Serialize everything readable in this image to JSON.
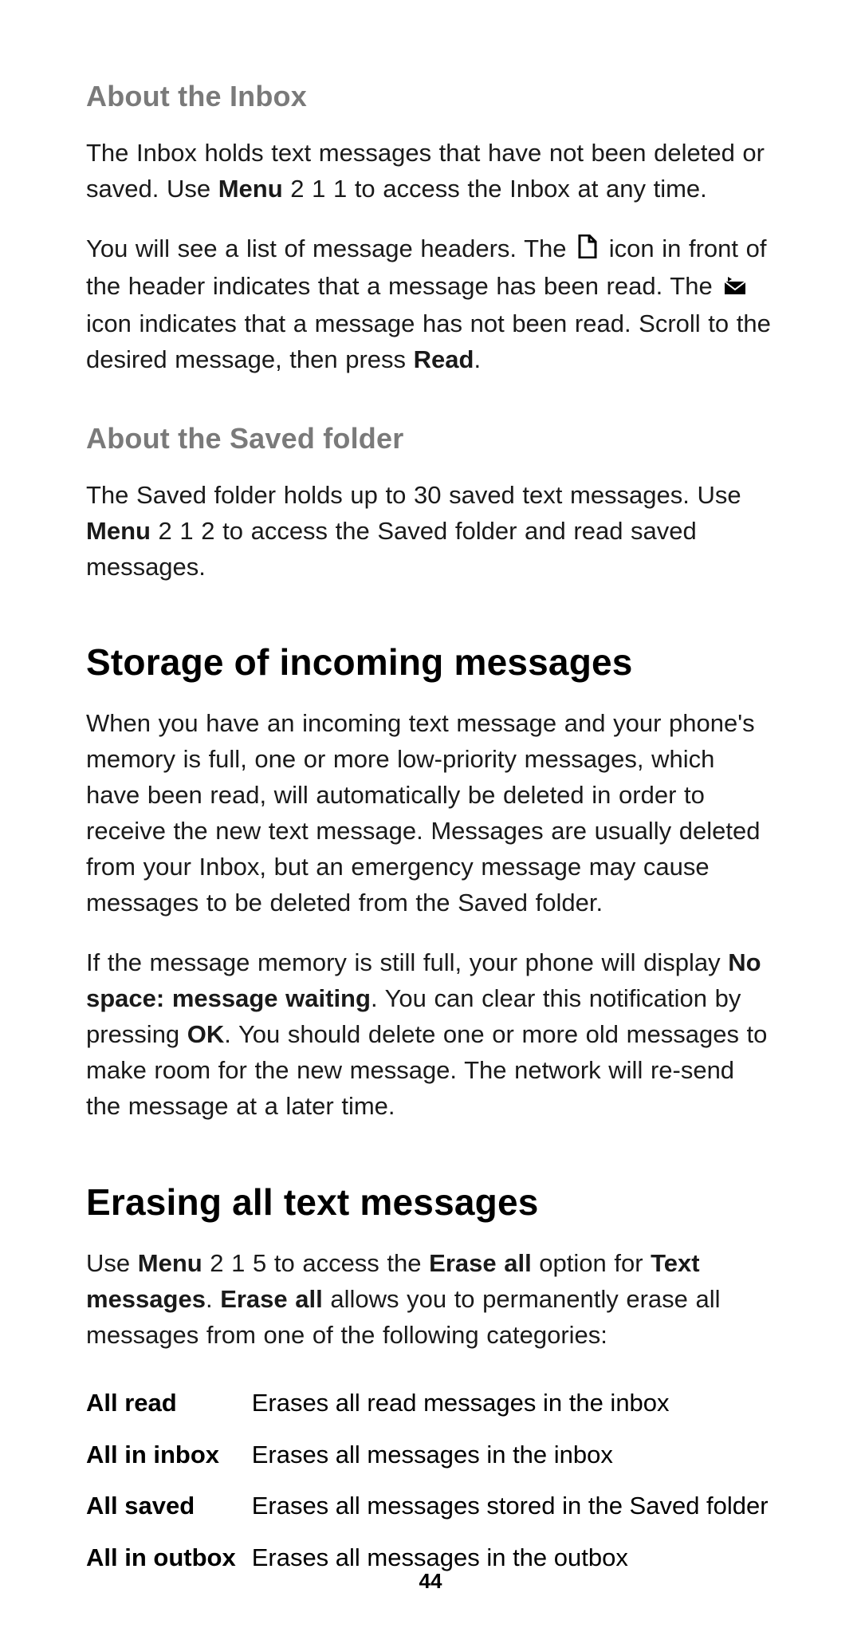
{
  "sec_inbox": {
    "heading": "About the Inbox",
    "p1_a": "The Inbox holds text messages that have not been deleted or saved. Use ",
    "p1_menu": "Menu",
    "p1_b": " 2 1 1 to access the Inbox at any time.",
    "p2_a": "You will see a list of message headers. The ",
    "p2_b": " icon in front of the header indicates that a message has been read. The ",
    "p2_c": " icon indicates that a message has not been read. Scroll to the desired message, then press ",
    "p2_read": "Read",
    "p2_d": "."
  },
  "sec_saved": {
    "heading": "About the Saved folder",
    "p1_a": "The Saved folder holds up to 30 saved text messages. Use ",
    "p1_menu": "Menu",
    "p1_b": " 2 1 2 to access the Saved folder and read saved messages."
  },
  "sec_storage": {
    "heading": "Storage of incoming messages",
    "p1": "When you have an incoming text message and your phone's memory is full, one or more low-priority messages, which have been read, will automatically be deleted in order to receive the new text message. Messages are usually deleted from your Inbox, but an emergency message may cause messages to be deleted from the Saved folder.",
    "p2_a": "If the message memory is still full, your phone will display ",
    "p2_nospace": "No space: message waiting",
    "p2_b": ". You can clear this notification by pressing ",
    "p2_ok": "OK",
    "p2_c": ". You should delete one or more old messages to make room for the new message. The network will re-send the message at a later time."
  },
  "sec_erase": {
    "heading": "Erasing all text messages",
    "p1_a": "Use ",
    "p1_menu": "Menu",
    "p1_b": " 2 1 5 to access the ",
    "p1_eraseall": "Erase all",
    "p1_c": " option for ",
    "p1_text": "Text messages",
    "p1_d": ". ",
    "p1_eraseall2": "Erase all",
    "p1_e": " allows you to permanently erase all messages from one of the following categories:",
    "rows": [
      {
        "term": "All read",
        "desc": "Erases all read messages in the inbox"
      },
      {
        "term": "All in inbox",
        "desc": "Erases all messages in the inbox"
      },
      {
        "term": "All saved",
        "desc": "Erases all messages stored in the Saved folder"
      },
      {
        "term": "All in outbox",
        "desc": "Erases all messages in the outbox"
      }
    ]
  },
  "page_number": "44"
}
